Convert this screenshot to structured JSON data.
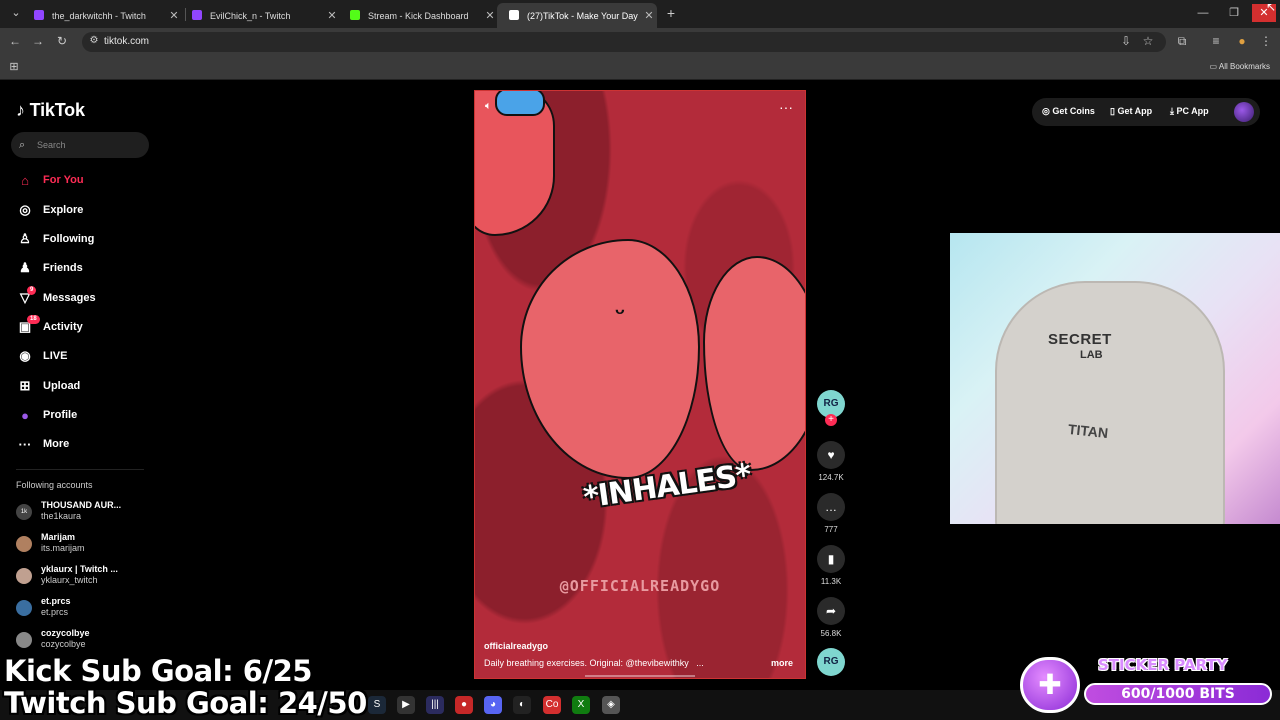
{
  "browser": {
    "tabs": [
      {
        "title": "the_darkwitchh - Twitch",
        "favicon_color": "#9146ff"
      },
      {
        "title": "EvilChick_n - Twitch",
        "favicon_color": "#9146ff"
      },
      {
        "title": "Stream - Kick Dashboard",
        "favicon_color": "#53fc18"
      },
      {
        "title": "(27)TikTok - Make Your Day",
        "favicon_color": "#ffffff"
      }
    ],
    "url": "tiktok.com",
    "bookmarks_label": "All Bookmarks"
  },
  "sidebar": {
    "logo": "TikTok",
    "search_placeholder": "Search",
    "nav": [
      {
        "label": "For You",
        "icon": "home-icon",
        "active": true
      },
      {
        "label": "Explore",
        "icon": "compass-icon"
      },
      {
        "label": "Following",
        "icon": "following-icon"
      },
      {
        "label": "Friends",
        "icon": "friends-icon"
      },
      {
        "label": "Messages",
        "icon": "messages-icon",
        "badge": "9"
      },
      {
        "label": "Activity",
        "icon": "activity-icon",
        "badge": "18"
      },
      {
        "label": "LIVE",
        "icon": "live-icon"
      },
      {
        "label": "Upload",
        "icon": "upload-icon"
      },
      {
        "label": "Profile",
        "icon": "profile-icon"
      },
      {
        "label": "More",
        "icon": "more-icon"
      }
    ],
    "following_title": "Following accounts",
    "accounts": [
      {
        "name": "THOUSAND AUR...",
        "handle": "the1kaura",
        "color": "#444"
      },
      {
        "name": "Marijam",
        "handle": "its.marijam",
        "color": "#b08060"
      },
      {
        "name": "yklaurx | Twitch ...",
        "handle": "yklaurx_twitch",
        "color": "#c0a090"
      },
      {
        "name": "et.prcs",
        "handle": "et.prcs",
        "color": "#3a6ea0"
      },
      {
        "name": "cozycolbye",
        "handle": "cozycolbye",
        "color": "#888"
      }
    ]
  },
  "video": {
    "overlay_text": "*INHALES*",
    "watermark": "@OFFICIALREADYGO",
    "username": "officialreadygo",
    "description": "Daily breathing exercises. Original: @thevibewithky",
    "ellipsis": "...",
    "more_label": "more"
  },
  "actions": {
    "avatar_text": "RG",
    "likes": "124.7K",
    "comments": "777",
    "saves": "11.3K",
    "shares": "56.8K"
  },
  "topbar": {
    "coins": "Get Coins",
    "app": "Get App",
    "pc": "PC App"
  },
  "webcam": {
    "chair_brand": "SECRET",
    "chair_brand2": "LAB",
    "chair_model": "TITAN"
  },
  "stream_overlay": {
    "kick_goal": "Kick Sub Goal: 6/25",
    "twitch_goal": "Twitch Sub Goal: 24/50",
    "sticker_title": "STICKER PARTY",
    "bits": "600/1000 BITS",
    "bits_progress": 0.6
  }
}
